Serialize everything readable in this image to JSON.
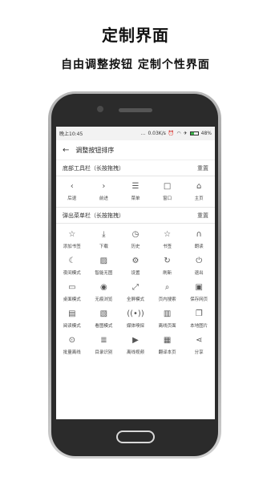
{
  "heading": {
    "title": "定制界面",
    "subtitle": "自由调整按钮 定制个性界面"
  },
  "status": {
    "time": "晚上10:45",
    "dots": "...",
    "speed": "0.03K/s",
    "battery_pct": "48%",
    "battery_level": 0.48
  },
  "appbar": {
    "back_icon": "←",
    "title": "调整按钮排序"
  },
  "bottom_toolbar": {
    "title": "底部工具栏（长按拖拽）",
    "reset": "重置",
    "items": [
      {
        "icon": "‹",
        "label": "后退"
      },
      {
        "icon": "›",
        "label": "前进"
      },
      {
        "icon": "☰",
        "label": "菜单"
      },
      {
        "icon": "□",
        "label": "窗口"
      },
      {
        "icon": "⌂",
        "label": "主页"
      }
    ]
  },
  "popup_menu": {
    "title": "弹出菜单栏（长按拖拽）",
    "reset": "重置",
    "items": [
      {
        "icon": "☆",
        "label": "添加书签"
      },
      {
        "icon": "⤓",
        "label": "下载"
      },
      {
        "icon": "◷",
        "label": "历史"
      },
      {
        "icon": "☆",
        "label": "书签"
      },
      {
        "icon": "∩",
        "label": "朗读"
      },
      {
        "icon": "☾",
        "label": "夜间模式"
      },
      {
        "icon": "▨",
        "label": "智能无图"
      },
      {
        "icon": "⚙",
        "label": "设置"
      },
      {
        "icon": "↻",
        "label": "刷新"
      },
      {
        "icon": "⏻",
        "label": "退出"
      },
      {
        "icon": "▭",
        "label": "桌面模式"
      },
      {
        "icon": "◉",
        "label": "无痕浏览"
      },
      {
        "icon": "⤢",
        "label": "全屏模式"
      },
      {
        "icon": "⌕",
        "label": "页内搜索"
      },
      {
        "icon": "▣",
        "label": "保存网页"
      },
      {
        "icon": "▤",
        "label": "阅读模式"
      },
      {
        "icon": "▧",
        "label": "看图模式"
      },
      {
        "icon": "((•))",
        "label": "媒体嗅探"
      },
      {
        "icon": "▥",
        "label": "离线页面"
      },
      {
        "icon": "❐",
        "label": "本地图片"
      },
      {
        "icon": "⊙",
        "label": "批量离线"
      },
      {
        "icon": "≣",
        "label": "目录识别"
      },
      {
        "icon": "▶",
        "label": "离线视频"
      },
      {
        "icon": "▦",
        "label": "翻译本页"
      },
      {
        "icon": "⋖",
        "label": "分享"
      }
    ]
  }
}
